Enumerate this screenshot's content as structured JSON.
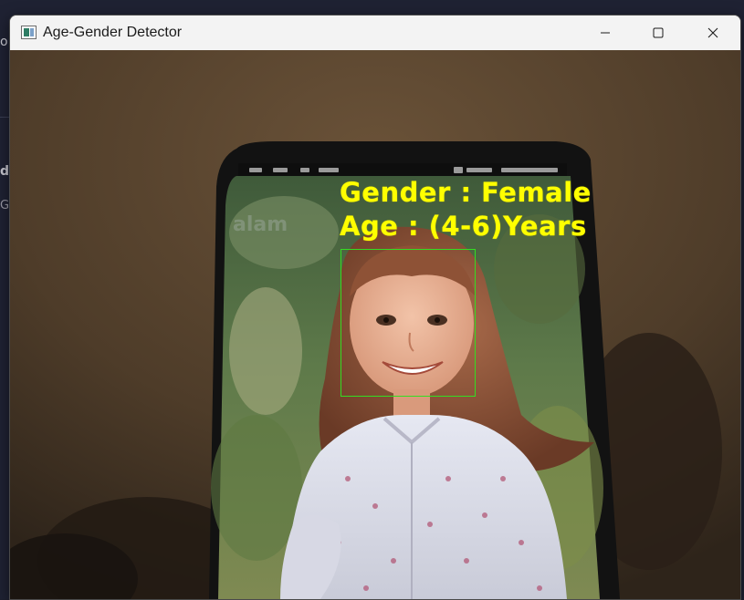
{
  "window": {
    "title": "Age-Gender Detector",
    "icon": "app-window-icon",
    "controls": [
      "minimize-icon",
      "maximize-icon",
      "close-icon"
    ]
  },
  "detection": {
    "gender_label": "Gender : Female",
    "age_label": "Age : (4-6)Years",
    "text_color": "#ffff00",
    "box_color": "#33dd22"
  },
  "background_fragments": [
    "o",
    "d",
    "G"
  ]
}
